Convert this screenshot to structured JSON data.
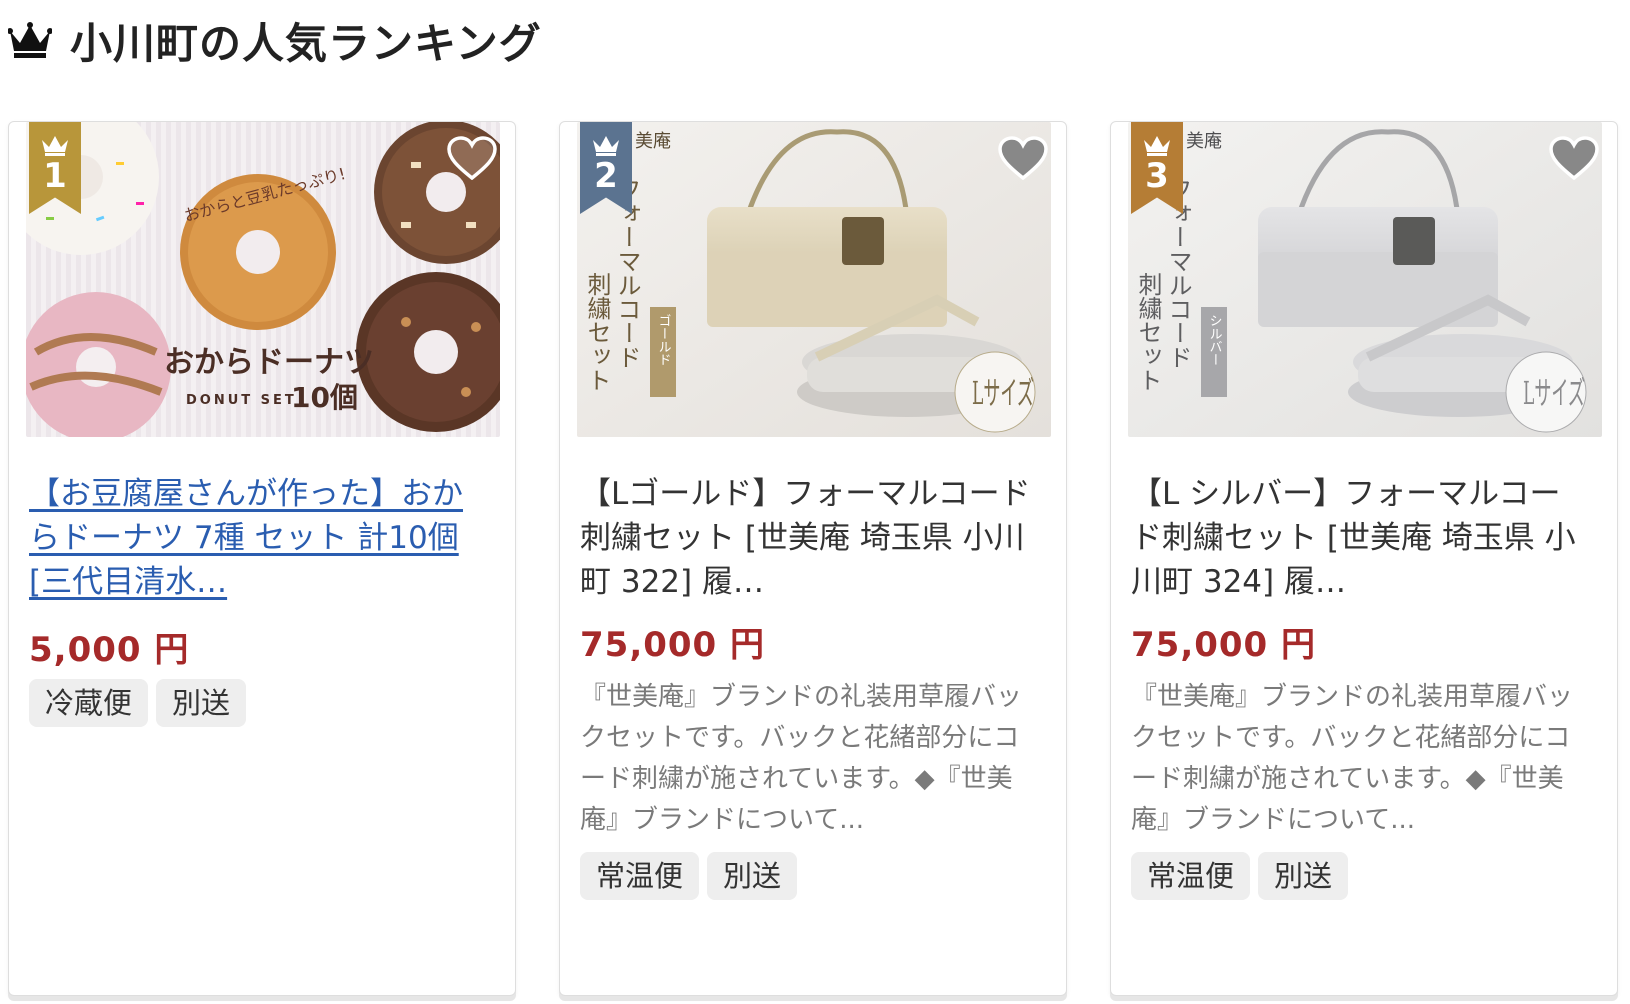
{
  "header": {
    "title": "小川町の人気ランキング",
    "icon": "crown-icon"
  },
  "colors": {
    "gold": "#b8963a",
    "silver_blue": "#5b7390",
    "bronze": "#b57d35",
    "price": "#a52a2a",
    "link": "#2a5db0"
  },
  "cards": [
    {
      "rank": "1",
      "title": "【お豆腐屋さんが作った】おからドーナツ 7種 セット 計10個 [三代目清水…",
      "price": "5,000 円",
      "tags": [
        "冷蔵便",
        "別送"
      ],
      "image_text": {
        "tagline": "おからと豆乳たっぷり!",
        "name": "おからドーナツ",
        "set": "DONUT SET",
        "count": "10個"
      }
    },
    {
      "rank": "2",
      "title": "【Lゴールド】フォーマルコード刺繍セット [世美庵 埼玉県 小川町 322] 履…",
      "price": "75,000 円",
      "description": "『世美庵』ブランドの礼装用草履バックセットです。バックと花緒部分にコード刺繍が施されています。◆『世美庵』ブランドについて...",
      "tags": [
        "常温便",
        "別送"
      ],
      "image_text": {
        "brand": "美庵",
        "line1": "フォーマルコード",
        "line2": "刺繍セット",
        "variant": "ゴールド",
        "size": "Lサイズ"
      }
    },
    {
      "rank": "3",
      "title": "【L シルバー】フォーマルコード刺繍セット [世美庵 埼玉県 小川町 324] 履…",
      "price": "75,000 円",
      "description": "『世美庵』ブランドの礼装用草履バックセットです。バックと花緒部分にコード刺繍が施されています。◆『世美庵』ブランドについて...",
      "tags": [
        "常温便",
        "別送"
      ],
      "image_text": {
        "brand": "美庵",
        "line1": "フォーマルコード",
        "line2": "刺繍セット",
        "variant": "シルバー",
        "size": "Lサイズ"
      }
    }
  ]
}
